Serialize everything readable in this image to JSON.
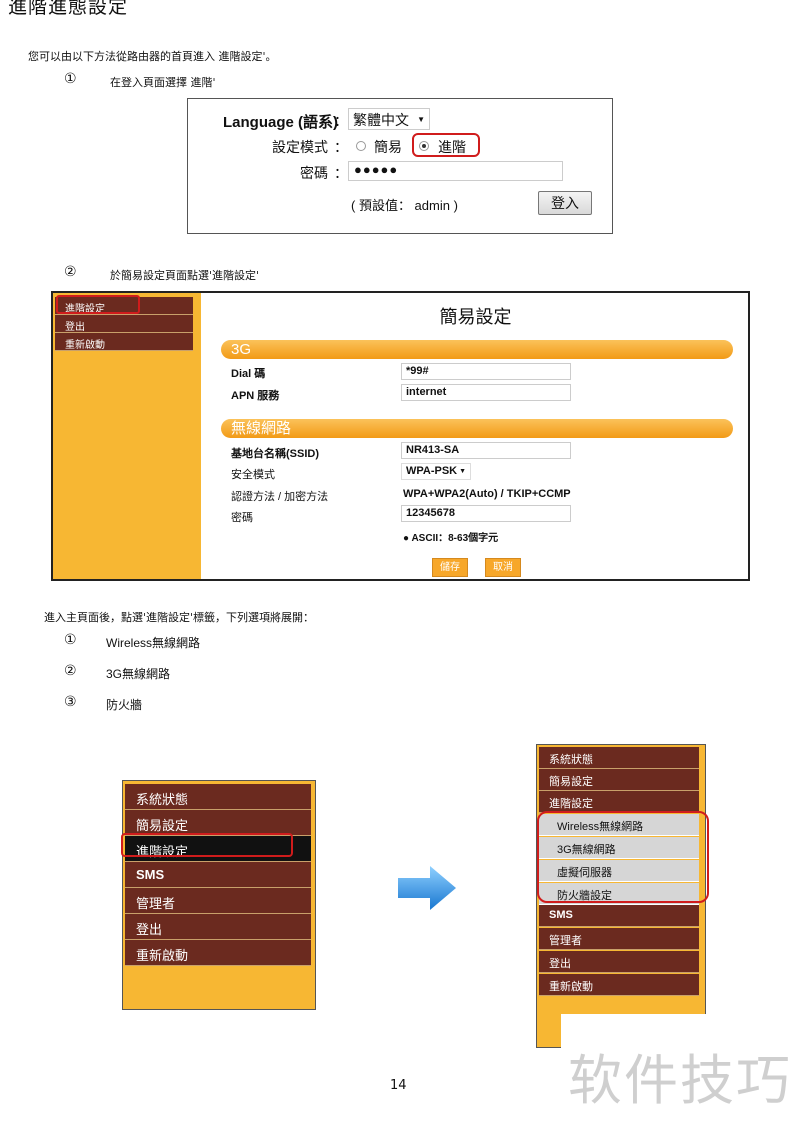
{
  "doc": {
    "title": "進階進態設定",
    "intro": "您可以由以下方法從路由器的首頁進入 進階設定'。",
    "step1_num": "①",
    "step1_text": "在登入頁面選擇 進階'",
    "step2_num": "②",
    "step2_text": "於簡易設定頁面點選'進階設定'",
    "expand_text": "進入主頁面後，點選'進階設定'標籤，下列選項將展開：",
    "list": [
      {
        "num": "①",
        "text": "Wireless無線網路"
      },
      {
        "num": "②",
        "text": "3G無線網路"
      },
      {
        "num": "③",
        "text": "防火牆"
      }
    ],
    "page_number": "14",
    "watermark": "软件技巧"
  },
  "login": {
    "language_label": "Language (語系)",
    "language_value": "繁體中文",
    "mode_label": "設定模式",
    "mode_simple": "簡易",
    "mode_advanced": "進階",
    "mode_selected": "進階",
    "password_label": "密碼",
    "password_value": "●●●●●",
    "default_hint": "( 預設值： admin )",
    "login_button": "登入",
    "colon": "："
  },
  "setup": {
    "sidebar": [
      "進階設定",
      "登出",
      "重新啟動"
    ],
    "title": "簡易設定",
    "section_3g": "3G",
    "dial_label": "Dial 碼",
    "dial_value": "*99#",
    "apn_label": "APN 服務",
    "apn_value": "internet",
    "section_wireless": "無線網路",
    "ssid_label": "基地台名稱(SSID)",
    "ssid_value": "NR413-SA",
    "security_label": "安全模式",
    "security_value": "WPA-PSK",
    "auth_label": "認證方法 / 加密方法",
    "auth_value": "WPA+WPA2(Auto) / TKIP+CCMP",
    "key_label": "密碼",
    "key_value": "12345678",
    "key_hint": "ASCII：8-63個字元",
    "save_button": "儲存",
    "cancel_button": "取消"
  },
  "menu_before": [
    "系統狀態",
    "簡易設定",
    "進階設定",
    "SMS",
    "管理者",
    "登出",
    "重新啟動"
  ],
  "menu_after": {
    "top": [
      "系統狀態",
      "簡易設定",
      "進階設定"
    ],
    "sub": [
      "Wireless無線網路",
      "3G無線網路",
      "虛擬伺服器",
      "防火牆設定"
    ],
    "bottom": [
      "SMS",
      "管理者",
      "登出",
      "重新啟動"
    ]
  },
  "colors": {
    "menu_bg": "#6b2a1f",
    "sidebar_bg": "#f7b733",
    "highlight": "#d01c1c",
    "arrow": "#1f8fe0"
  }
}
